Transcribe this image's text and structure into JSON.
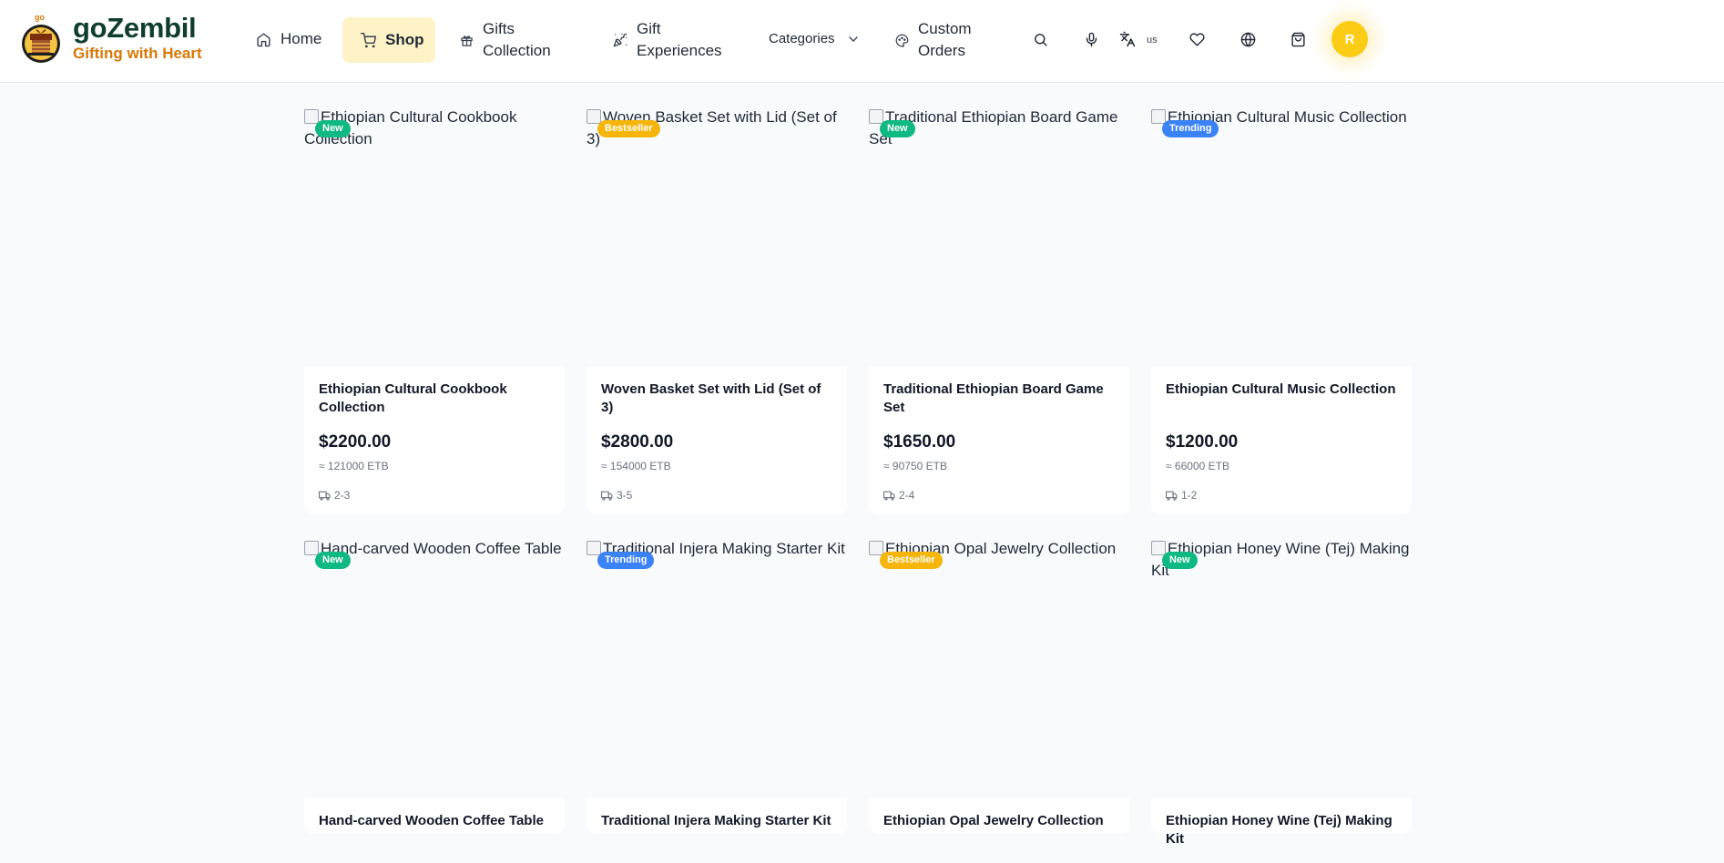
{
  "brand": {
    "name": "goZembil",
    "tagline": "Gifting with Heart",
    "logo_small_text": "go"
  },
  "nav": {
    "home": "Home",
    "shop": "Shop",
    "gifts_line1": "Gifts",
    "gifts_line2": "Collection",
    "experiences_line1": "Gift",
    "experiences_line2": "Experiences",
    "categories": "Categories",
    "custom_line1": "Custom",
    "custom_line2": "Orders"
  },
  "toolbar": {
    "language": "us",
    "avatar_initial": "R"
  },
  "colors": {
    "badge_new": "#10b981",
    "badge_bestseller": "#f5b50a",
    "badge_trending": "#3b82f6",
    "brand_green": "#0f3d2e",
    "brand_orange": "#d97706",
    "active_nav_bg": "#fef3c7"
  },
  "products": [
    {
      "image_alt": "Ethiopian Cultural Cookbook Collection",
      "badge": "New",
      "badge_type": "new",
      "title": "Ethiopian Cultural Cookbook Collection",
      "price": "$2200.00",
      "etb": "≈ 121000 ETB",
      "delivery": "2-3"
    },
    {
      "image_alt": "Woven Basket Set with Lid (Set of 3)",
      "badge": "Bestseller",
      "badge_type": "bestseller",
      "title": "Woven Basket Set with Lid (Set of 3)",
      "price": "$2800.00",
      "etb": "≈ 154000 ETB",
      "delivery": "3-5"
    },
    {
      "image_alt": "Traditional Ethiopian Board Game Set",
      "badge": "New",
      "badge_type": "new",
      "title": "Traditional Ethiopian Board Game Set",
      "price": "$1650.00",
      "etb": "≈ 90750 ETB",
      "delivery": "2-4"
    },
    {
      "image_alt": "Ethiopian Cultural Music Collection",
      "badge": "Trending",
      "badge_type": "trending",
      "title": "Ethiopian Cultural Music Collection",
      "price": "$1200.00",
      "etb": "≈ 66000 ETB",
      "delivery": "1-2"
    },
    {
      "image_alt": "Hand-carved Wooden Coffee Table",
      "badge": "New",
      "badge_type": "new",
      "title": "Hand-carved Wooden Coffee Table"
    },
    {
      "image_alt": "Traditional Injera Making Starter Kit",
      "badge": "Trending",
      "badge_type": "trending",
      "title": "Traditional Injera Making Starter Kit"
    },
    {
      "image_alt": "Ethiopian Opal Jewelry Collection",
      "badge": "Bestseller",
      "badge_type": "bestseller",
      "title": "Ethiopian Opal Jewelry Collection"
    },
    {
      "image_alt": "Ethiopian Honey Wine (Tej) Making Kit",
      "badge": "New",
      "badge_type": "new",
      "title": "Ethiopian Honey Wine (Tej) Making Kit"
    }
  ]
}
